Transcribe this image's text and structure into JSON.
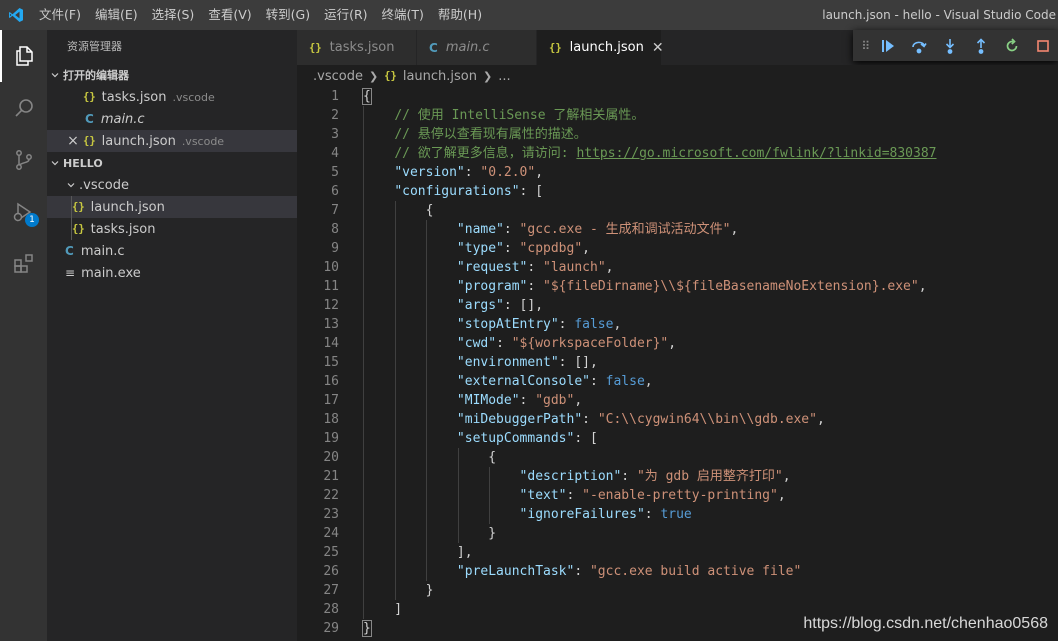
{
  "window": {
    "title": "launch.json - hello - Visual Studio Code",
    "menu": [
      "文件(F)",
      "编辑(E)",
      "选择(S)",
      "查看(V)",
      "转到(G)",
      "运行(R)",
      "终端(T)",
      "帮助(H)"
    ]
  },
  "activity_bar": {
    "icons": [
      "explorer-icon",
      "search-icon",
      "source-control-icon",
      "run-debug-icon",
      "extensions-icon"
    ],
    "debug_badge": "1"
  },
  "sidebar": {
    "title": "资源管理器",
    "open_editors": {
      "header": "打开的编辑器",
      "items": [
        {
          "name": "tasks.json",
          "desc": ".vscode",
          "icon": "json"
        },
        {
          "name": "main.c",
          "desc": "",
          "icon": "c"
        },
        {
          "name": "launch.json",
          "desc": ".vscode",
          "icon": "json"
        }
      ]
    },
    "workspace": {
      "header": "HELLO",
      "folder": ".vscode",
      "folder_files": [
        "launch.json",
        "tasks.json"
      ],
      "root_files": [
        "main.c",
        "main.exe"
      ]
    }
  },
  "tabs": [
    {
      "label": "tasks.json",
      "icon": "json"
    },
    {
      "label": "main.c",
      "icon": "c"
    },
    {
      "label": "launch.json",
      "icon": "json",
      "active": true
    }
  ],
  "debug_toolbar": [
    "continue-icon",
    "step-over-icon",
    "step-into-icon",
    "step-out-icon",
    "restart-icon",
    "stop-icon"
  ],
  "breadcrumbs": {
    "folder": ".vscode",
    "file": "launch.json",
    "more": "..."
  },
  "editor": {
    "line_numbers": [
      "1",
      "2",
      "3",
      "4",
      "5",
      "6",
      "7",
      "8",
      "9",
      "10",
      "11",
      "12",
      "13",
      "14",
      "15",
      "16",
      "17",
      "18",
      "19",
      "20",
      "21",
      "22",
      "23",
      "24",
      "25",
      "26",
      "27",
      "28",
      "29"
    ],
    "code": {
      "comment1": "// 使用 IntelliSense 了解相关属性。",
      "comment2": "// 悬停以查看现有属性的描述。",
      "comment3_text": "// 欲了解更多信息，请访问: ",
      "comment3_link": "https://go.microsoft.com/fwlink/?linkid=830387",
      "version_key": "\"version\"",
      "version_val": "\"0.2.0\"",
      "configurations_key": "\"configurations\"",
      "name_key": "\"name\"",
      "name_val": "\"gcc.exe - 生成和调试活动文件\"",
      "type_key": "\"type\"",
      "type_val": "\"cppdbg\"",
      "request_key": "\"request\"",
      "request_val": "\"launch\"",
      "program_key": "\"program\"",
      "program_val": "\"${fileDirname}\\\\${fileBasenameNoExtension}.exe\"",
      "args_key": "\"args\"",
      "stopAtEntry_key": "\"stopAtEntry\"",
      "stopAtEntry_val": "false",
      "cwd_key": "\"cwd\"",
      "cwd_val": "\"${workspaceFolder}\"",
      "environment_key": "\"environment\"",
      "externalConsole_key": "\"externalConsole\"",
      "externalConsole_val": "false",
      "MIMode_key": "\"MIMode\"",
      "MIMode_val": "\"gdb\"",
      "miDebuggerPath_key": "\"miDebuggerPath\"",
      "miDebuggerPath_val": "\"C:\\\\cygwin64\\\\bin\\\\gdb.exe\"",
      "setupCommands_key": "\"setupCommands\"",
      "description_key": "\"description\"",
      "description_val": "\"为 gdb 启用整齐打印\"",
      "text_key": "\"text\"",
      "text_val": "\"-enable-pretty-printing\"",
      "ignoreFailures_key": "\"ignoreFailures\"",
      "ignoreFailures_val": "true",
      "preLaunchTask_key": "\"preLaunchTask\"",
      "preLaunchTask_val": "\"gcc.exe build active file\""
    }
  },
  "watermark": "https://blog.csdn.net/chenhao0568",
  "colors": {
    "accent": "#007acc",
    "json_icon": "#cbcb41",
    "c_icon": "#519aba",
    "debug_blue": "#75beff",
    "debug_green": "#89d185",
    "debug_red": "#f48771"
  }
}
